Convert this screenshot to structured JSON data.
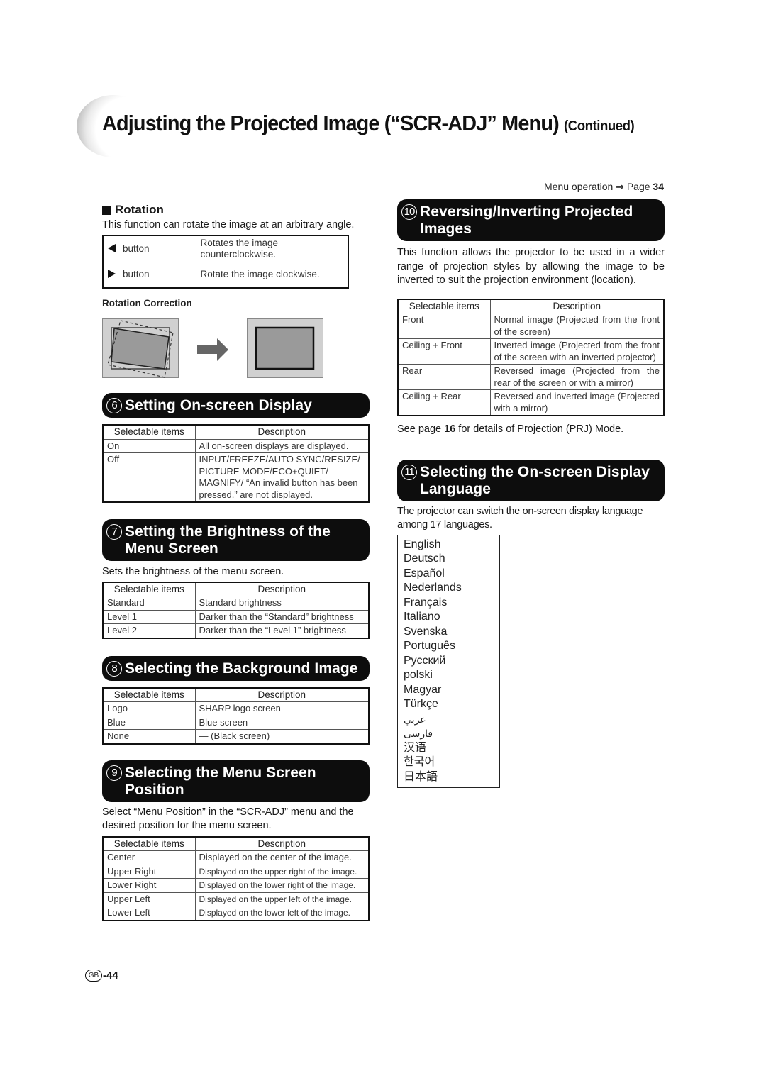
{
  "header": {
    "title": "Adjusting the Projected Image (“SCR-ADJ” Menu)",
    "title_suffix": "(Continued)",
    "menu_operation_label": "Menu operation",
    "menu_operation_arrow": "⇒",
    "menu_operation_page_label": "Page",
    "menu_operation_page_number": "34"
  },
  "rotation": {
    "heading": "Rotation",
    "description": "This function can rotate the image at an arbitrary angle.",
    "rows": [
      {
        "icon": "left-triangle-icon",
        "button": "button",
        "desc": "Rotates the image counterclockwise."
      },
      {
        "icon": "right-triangle-icon",
        "button": "button",
        "desc": "Rotate the image clockwise."
      }
    ],
    "correction_label": "Rotation Correction"
  },
  "sections": {
    "s6": {
      "number": "⑥",
      "title": "Setting On-screen Display",
      "headers": [
        "Selectable items",
        "Description"
      ],
      "rows": [
        [
          "On",
          "All on-screen displays are displayed."
        ],
        [
          "Off",
          "INPUT/FREEZE/AUTO SYNC/RESIZE/ PICTURE MODE/ECO+QUIET/ MAGNIFY/ “An invalid button has been pressed.” are not displayed."
        ]
      ]
    },
    "s7": {
      "number": "⑦",
      "title": "Setting the Brightness of the Menu Screen",
      "intro": "Sets the brightness of the menu screen.",
      "headers": [
        "Selectable items",
        "Description"
      ],
      "rows": [
        [
          "Standard",
          "Standard brightness"
        ],
        [
          "Level 1",
          "Darker than the “Standard” brightness"
        ],
        [
          "Level 2",
          "Darker than the “Level 1” brightness"
        ]
      ]
    },
    "s8": {
      "number": "⑧",
      "title": "Selecting the Background Image",
      "headers": [
        "Selectable items",
        "Description"
      ],
      "rows": [
        [
          "Logo",
          "SHARP logo screen"
        ],
        [
          "Blue",
          "Blue screen"
        ],
        [
          "None",
          "— (Black screen)"
        ]
      ]
    },
    "s9": {
      "number": "⑨",
      "title": "Selecting the Menu Screen Position",
      "intro": "Select “Menu Position” in the “SCR-ADJ” menu and the desired position for the menu screen.",
      "headers": [
        "Selectable items",
        "Description"
      ],
      "rows": [
        [
          "Center",
          "Displayed on the center of the image."
        ],
        [
          "Upper Right",
          "Displayed on the upper right of the image."
        ],
        [
          "Lower Right",
          "Displayed on the lower right of the image."
        ],
        [
          "Upper Left",
          "Displayed on the upper left of the image."
        ],
        [
          "Lower Left",
          "Displayed on the lower left of the image."
        ]
      ]
    },
    "s10": {
      "number": "⑩",
      "title": "Reversing/Inverting Projected Images",
      "intro": "This function allows the projector to be used in a wider range of projection styles by allowing the image to be inverted to suit the projection environment (location).",
      "headers": [
        "Selectable items",
        "Description"
      ],
      "rows": [
        [
          "Front",
          "Normal image (Projected from the front of the screen)"
        ],
        [
          "Ceiling + Front",
          "Inverted image (Projected from the front of the screen with an inverted projector)"
        ],
        [
          "Rear",
          "Reversed image (Projected from the rear of the screen or with a mirror)"
        ],
        [
          "Ceiling + Rear",
          "Reversed and inverted image (Projected with a mirror)"
        ]
      ],
      "note_prefix": "See page",
      "note_page": "16",
      "note_suffix": "for details of Projection (PRJ) Mode."
    },
    "s11": {
      "number": "⑪",
      "title": "Selecting the On-screen Display Language",
      "intro": "The projector can switch the on-screen display language among 17 languages.",
      "languages": [
        "English",
        "Deutsch",
        "Español",
        "Nederlands",
        "Français",
        "Italiano",
        "Svenska",
        "Português",
        "Русский",
        "polski",
        "Magyar",
        "Türkçe",
        "عربي",
        "فارسی",
        "汉语",
        "한국어",
        "日本語"
      ]
    }
  },
  "footer": {
    "region_badge": "GB",
    "page_number": "-44"
  }
}
